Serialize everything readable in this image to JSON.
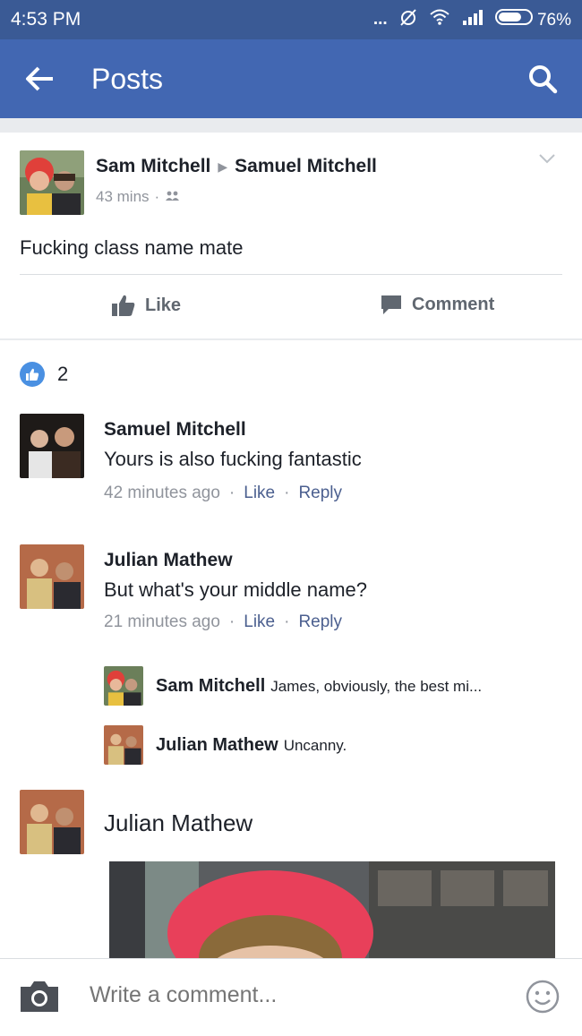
{
  "status_bar": {
    "time": "4:53 PM",
    "signal_dots": "...",
    "battery_percent": "76%",
    "battery_level": 0.76
  },
  "app_bar": {
    "title": "Posts",
    "back_icon": "arrow-left-icon",
    "search_icon": "search-icon"
  },
  "post": {
    "author": "Sam Mitchell",
    "recipient": "Samuel Mitchell",
    "time": "43 mins",
    "audience_icon": "friends-icon",
    "text": "Fucking class name mate",
    "like_label": "Like",
    "comment_label": "Comment"
  },
  "reactions": {
    "count": "2",
    "icon": "like-icon"
  },
  "comments": [
    {
      "name": "Samuel Mitchell",
      "text": "Yours is also fucking fantastic",
      "time": "42 minutes ago",
      "like_label": "Like",
      "reply_label": "Reply"
    },
    {
      "name": "Julian Mathew",
      "text": "But what's your middle name?",
      "time": "21 minutes ago",
      "like_label": "Like",
      "reply_label": "Reply",
      "replies": [
        {
          "name": "Sam Mitchell",
          "text": "James, obviously, the best mi..."
        },
        {
          "name": "Julian Mathew",
          "text": "Uncanny."
        }
      ]
    },
    {
      "name": "Julian Mathew"
    }
  ],
  "composer": {
    "placeholder": "Write a comment...",
    "camera_icon": "camera-icon",
    "emoji_icon": "emoji-icon"
  },
  "colors": {
    "status_bar": "#3a5a95",
    "app_bar": "#4267b2",
    "link": "#4b5f8f",
    "muted": "#90949c",
    "like_blue": "#4a90e2"
  }
}
